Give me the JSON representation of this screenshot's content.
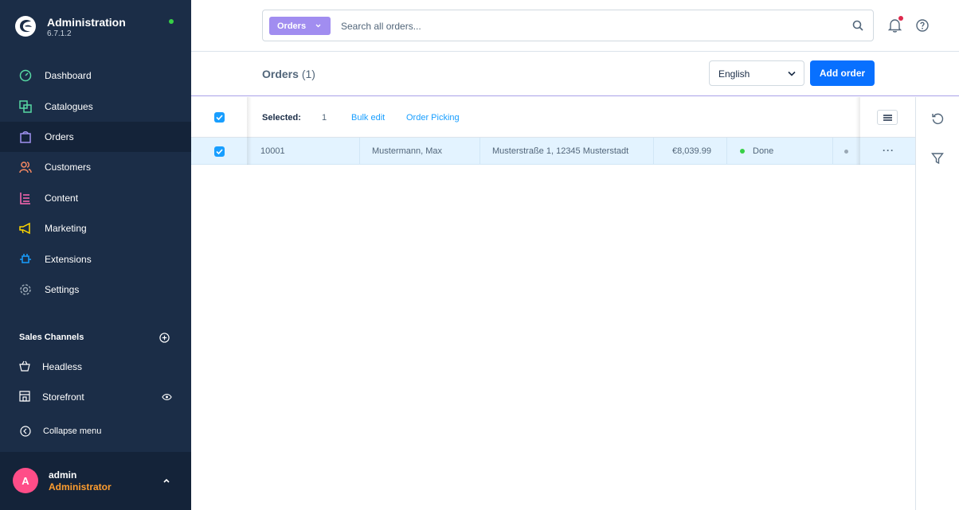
{
  "brand": {
    "title": "Administration",
    "version": "6.7.1.2"
  },
  "nav": [
    {
      "label": "Dashboard",
      "icon": "dashboard-icon",
      "color": "#57d9a3"
    },
    {
      "label": "Catalogues",
      "icon": "catalogues-icon",
      "color": "#57d9a3"
    },
    {
      "label": "Orders",
      "icon": "orders-icon",
      "color": "#a092f0"
    },
    {
      "label": "Customers",
      "icon": "customers-icon",
      "color": "#f88962"
    },
    {
      "label": "Content",
      "icon": "content-icon",
      "color": "#ff68b4"
    },
    {
      "label": "Marketing",
      "icon": "marketing-icon",
      "color": "#ffd700"
    },
    {
      "label": "Extensions",
      "icon": "extensions-icon",
      "color": "#189eff"
    },
    {
      "label": "Settings",
      "icon": "settings-icon",
      "color": "#9aa8b5"
    }
  ],
  "sales_channels": {
    "title": "Sales Channels",
    "items": [
      {
        "label": "Headless",
        "icon": "basket-icon"
      },
      {
        "label": "Storefront",
        "icon": "storefront-icon"
      }
    ]
  },
  "collapse_label": "Collapse menu",
  "user": {
    "initial": "A",
    "name": "admin",
    "role": "Administrator"
  },
  "search": {
    "type": "Orders",
    "placeholder": "Search all orders..."
  },
  "page": {
    "title": "Orders",
    "count": "(1)"
  },
  "language": "English",
  "add_button": "Add order",
  "bulk": {
    "selected_label": "Selected:",
    "selected_count": "1",
    "bulk_edit": "Bulk edit",
    "order_picking": "Order Picking"
  },
  "rows": [
    {
      "number": "10001",
      "customer": "Mustermann, Max",
      "address": "Musterstraße 1, 12345 Musterstadt",
      "amount": "€8,039.99",
      "status": "Done",
      "actions": "···"
    }
  ],
  "colors": {
    "sidebar": "#1b2d47",
    "accent": "#189eff",
    "primary_button": "#0870ff",
    "search_badge": "#a18df0",
    "status_done": "#37d046",
    "selected_row": "#e3f3ff"
  }
}
